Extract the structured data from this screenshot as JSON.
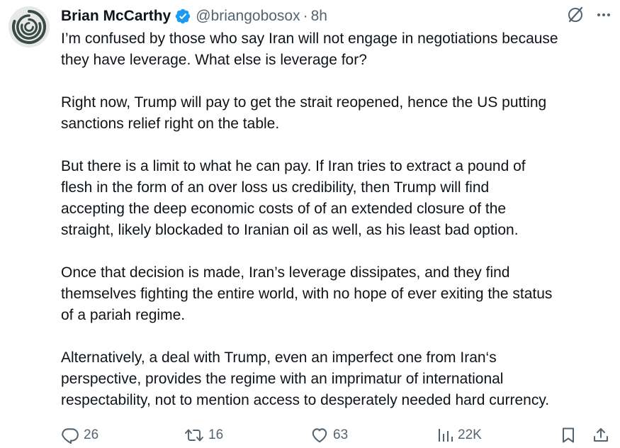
{
  "author": {
    "display_name": "Brian McCarthy",
    "handle": "@briangobosox",
    "time": "8h",
    "separator": "·",
    "verified": true
  },
  "icons": {
    "top": [
      "grok-slash-icon",
      "more-options-icon"
    ],
    "avatar": "spiral-logo-avatar"
  },
  "tweet": {
    "paragraphs": [
      "I’m confused by those who say Iran will not engage in negotiations because\nthey have leverage. What else is leverage for?",
      "Right now, Trump will pay to get the strait reopened, hence the US putting\nsanctions relief right on the table.",
      "But there is a limit to what he can pay. If Iran tries to extract a pound of\nflesh in the form of an over loss us credibility, then Trump will find\naccepting the deep economic costs of of an extended closure of the\nstraight, likely blockaded to Iranian oil as well, as his least bad option.",
      "Once that decision is made, Iran’s leverage dissipates, and they find\nthemselves fighting the entire world, with no hope of ever exiting the status\nof a pariah regime.",
      "Alternatively, a deal with Trump, even an imperfect one from Iran‘s\nperspective, provides the regime with  an imprimatur of international\nrespectability, not to mention access to desperately needed hard currency."
    ]
  },
  "actions": {
    "replies": "26",
    "reposts": "16",
    "likes": "63",
    "views": "22K"
  },
  "colors": {
    "text": "#0f1419",
    "secondary": "#536471",
    "verified_badge": "#1d9bf0",
    "avatar_bg": "#e7e9e6",
    "avatar_mark": "#3a4a44"
  }
}
